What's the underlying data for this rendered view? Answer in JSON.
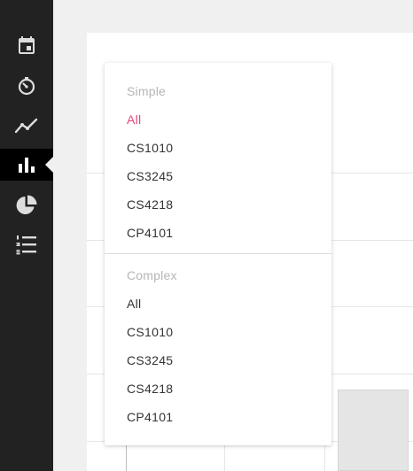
{
  "sidebar": {
    "items": [
      {
        "icon": "calendar-icon",
        "active": false
      },
      {
        "icon": "stopwatch-icon",
        "active": false
      },
      {
        "icon": "line-chart-icon",
        "active": false
      },
      {
        "icon": "bar-chart-icon",
        "active": true
      },
      {
        "icon": "pie-chart-icon",
        "active": false
      },
      {
        "icon": "numbered-list-icon",
        "active": false
      }
    ],
    "colors": {
      "background": "#222222",
      "active_background": "#000000",
      "icon": "#dddddd"
    }
  },
  "dropdown": {
    "groups": [
      {
        "header": "Simple",
        "options": [
          {
            "label": "All",
            "selected": true
          },
          {
            "label": "CS1010",
            "selected": false
          },
          {
            "label": "CS3245",
            "selected": false
          },
          {
            "label": "CS4218",
            "selected": false
          },
          {
            "label": "CP4101",
            "selected": false
          }
        ]
      },
      {
        "header": "Complex",
        "options": [
          {
            "label": "All",
            "selected": false
          },
          {
            "label": "CS1010",
            "selected": false
          },
          {
            "label": "CS3245",
            "selected": false
          },
          {
            "label": "CS4218",
            "selected": false
          },
          {
            "label": "CP4101",
            "selected": false
          }
        ]
      }
    ],
    "colors": {
      "selected": "#e8407a",
      "header": "#b5b5b5",
      "text": "#333333"
    }
  }
}
